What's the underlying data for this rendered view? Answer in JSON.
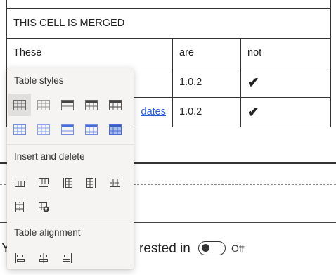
{
  "table": {
    "merged_cell": "THIS CELL IS MERGED",
    "header": [
      "These",
      "are",
      "not"
    ],
    "rows": [
      {
        "link": "",
        "version": "1.0.2",
        "mark": "✔"
      },
      {
        "link": "dates",
        "version": "1.0.2",
        "mark": "✔"
      }
    ]
  },
  "bottom": {
    "left_text": "Y",
    "right_text": "rested in",
    "toggle_label": "Off"
  },
  "popup": {
    "table_styles_title": "Table styles",
    "insert_delete_title": "Insert and delete",
    "alignment_title": "Table alignment",
    "style_icons": [
      "table-style-plain-icon",
      "table-style-grid-light-icon",
      "table-style-header-row-icon",
      "table-style-header-grid-icon",
      "table-style-dark-banded-icon",
      "table-style-blue-plain-icon",
      "table-style-blue-grid-icon",
      "table-style-blue-header-icon",
      "table-style-blue-banded-icon",
      "table-style-blue-dark-icon"
    ],
    "insert_icons": [
      "insert-row-above-icon",
      "insert-row-below-icon",
      "insert-column-left-icon",
      "insert-column-right-icon",
      "delete-row-icon",
      "delete-column-icon",
      "delete-table-icon"
    ],
    "alignment_icons": [
      "align-left-icon",
      "align-center-icon",
      "align-right-icon"
    ],
    "colors": {
      "gray": "#5a5a5a",
      "blue": "#4a6cd4"
    }
  }
}
